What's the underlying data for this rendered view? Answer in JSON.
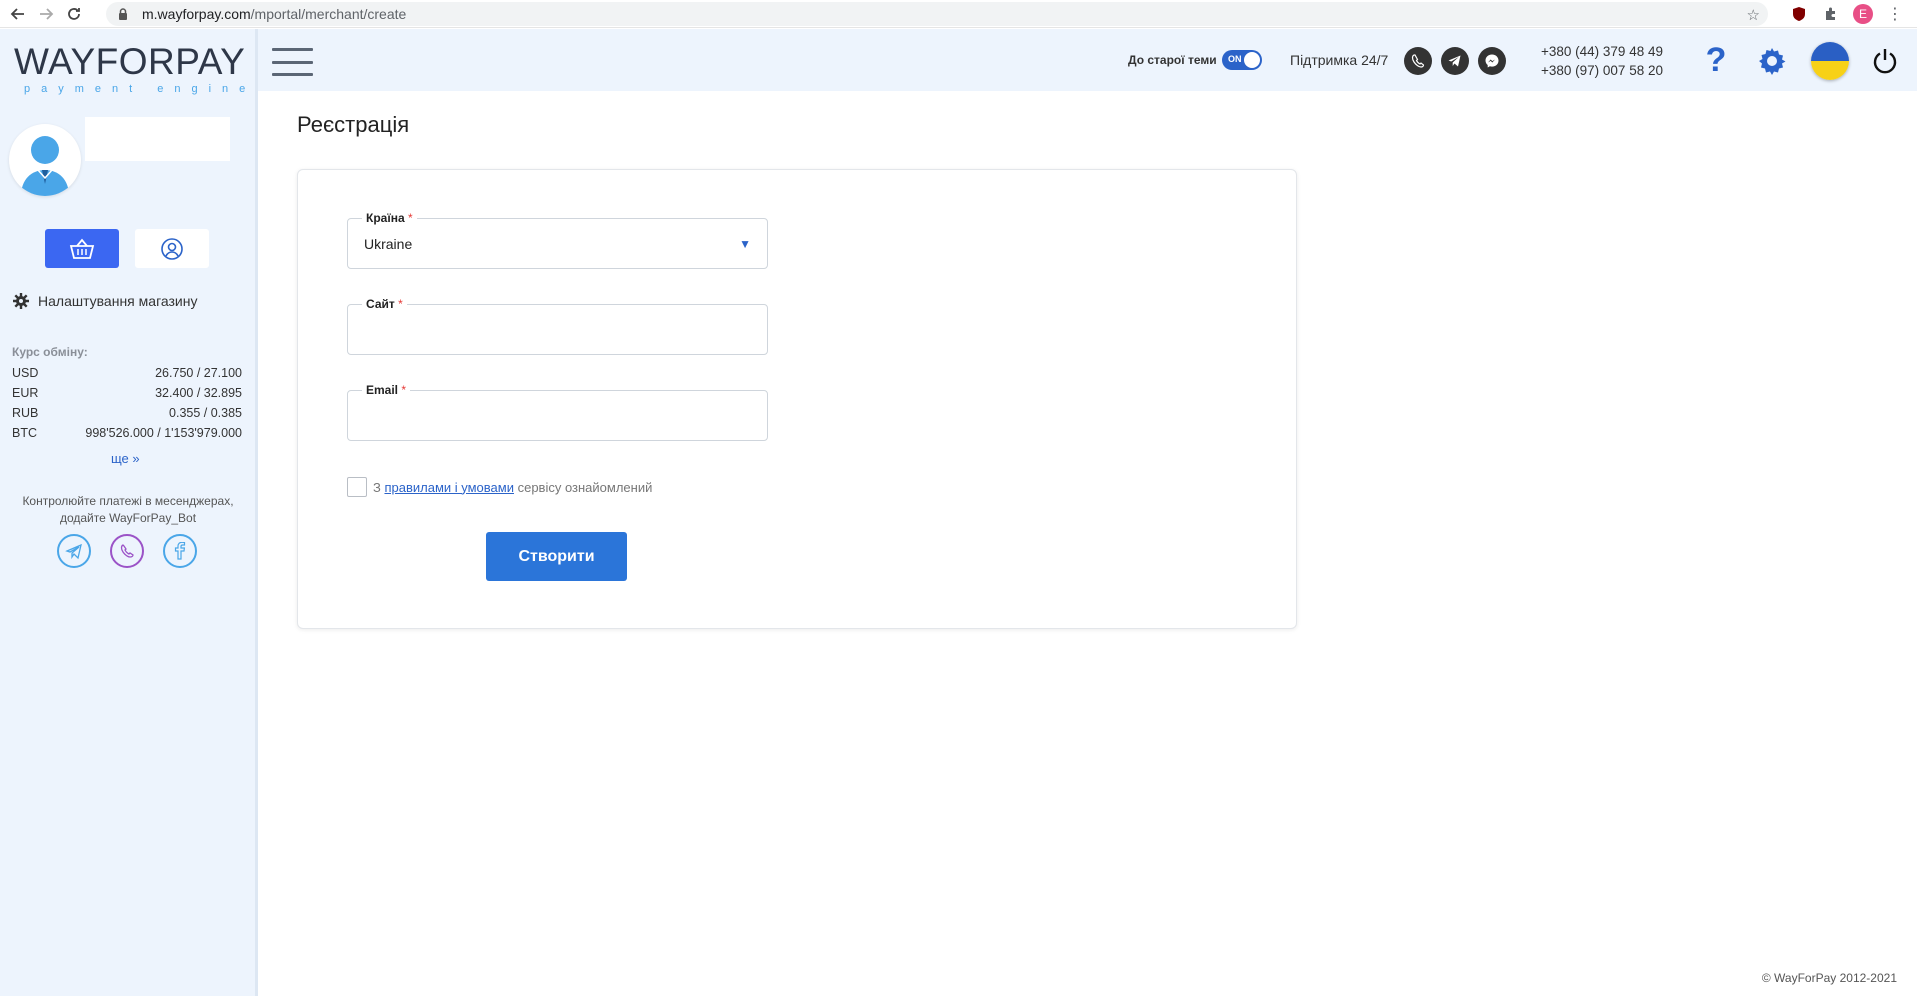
{
  "browser": {
    "url_host": "m.wayforpay.com",
    "url_path": "/mportal/merchant/create",
    "profile_initial": "E"
  },
  "logo": {
    "main": "WAYFORPAY",
    "sub": "payment engine"
  },
  "sidebar": {
    "settings_label": "Налаштування магазину",
    "rates_title": "Курс обміну:",
    "rates": [
      {
        "currency": "USD",
        "value": "26.750 / 27.100"
      },
      {
        "currency": "EUR",
        "value": "32.400 / 32.895"
      },
      {
        "currency": "RUB",
        "value": "0.355 / 0.385"
      },
      {
        "currency": "BTC",
        "value": "998'526.000 / 1'153'979.000"
      }
    ],
    "more_label": "ще »",
    "bot_text": "Контролюйте платежі в месенджерах, додайте WayForPay_Bot"
  },
  "header": {
    "old_theme_label": "До старої теми",
    "toggle_label": "ON",
    "support_label": "Підтримка 24/7",
    "phone1": "+380 (44) 379 48 49",
    "phone2": "+380 (97) 007 58 20",
    "help_glyph": "?"
  },
  "page": {
    "title": "Реєстрація",
    "country_label": "Країна",
    "country_value": "Ukraine",
    "site_label": "Сайт",
    "email_label": "Email",
    "required_mark": "*",
    "agree_prefix": "З ",
    "agree_link": "правилами і умовами",
    "agree_suffix": " сервісу ознайомлений",
    "create_label": "Створити"
  },
  "footer": {
    "copyright": "© WayForPay 2012-2021"
  },
  "colors": {
    "accent": "#2b75d9",
    "sidebar_bg": "#edf4fd",
    "shop_button": "#3b67f2"
  }
}
